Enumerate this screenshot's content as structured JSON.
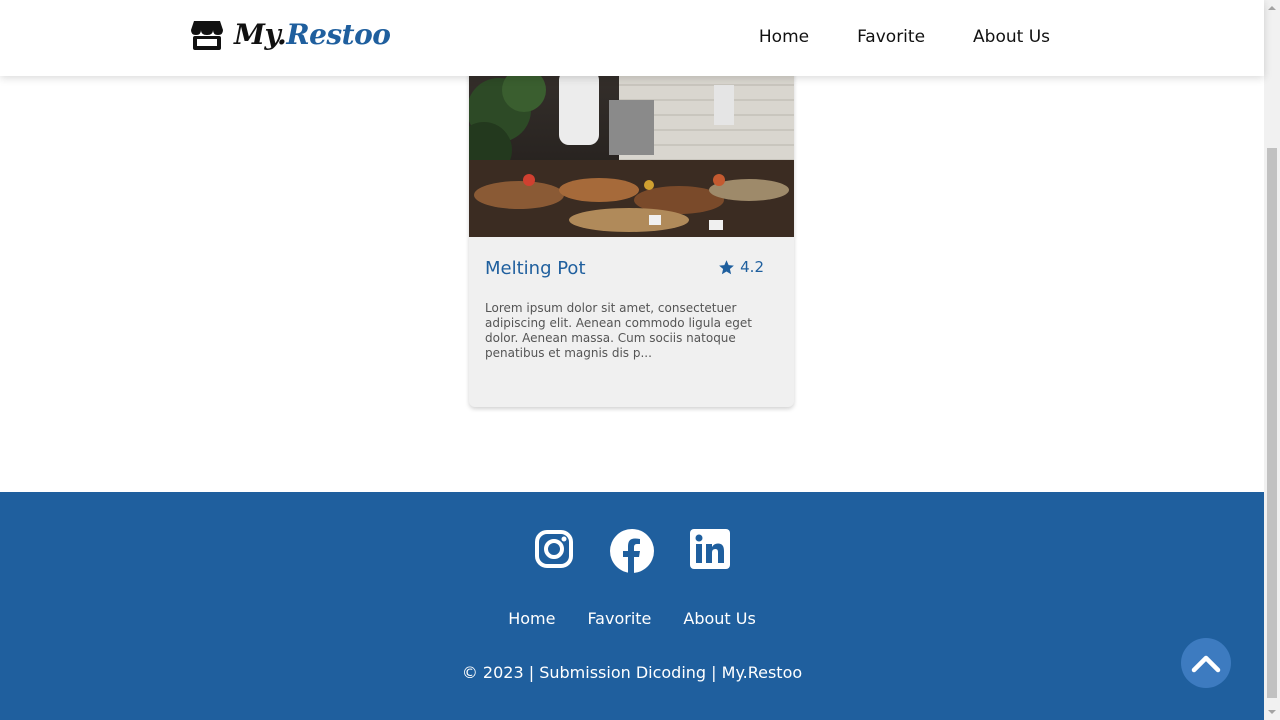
{
  "header": {
    "logo": {
      "prefix": "My.",
      "name": "Restoo",
      "icon": "store-icon"
    },
    "nav": [
      {
        "label": "Home"
      },
      {
        "label": "Favorite"
      },
      {
        "label": "About Us"
      }
    ]
  },
  "restaurant": {
    "name": "Melting Pot",
    "rating": "4.2",
    "rating_icon": "star-icon",
    "description": "Lorem ipsum dolor sit amet, consectetuer adipiscing elit. Aenean commodo ligula eget dolor. Aenean massa. Cum sociis natoque penatibus et magnis dis p...",
    "image_alt": "Melting Pot"
  },
  "footer": {
    "social": [
      "instagram-icon",
      "facebook-icon",
      "linkedin-icon"
    ],
    "nav": [
      {
        "label": "Home"
      },
      {
        "label": "Favorite"
      },
      {
        "label": "About Us"
      }
    ],
    "copyright": "© 2023 | Submission Dicoding | My.Restoo"
  },
  "back_to_top_icon": "chevron-up-icon",
  "colors": {
    "primary": "#1f5f9e",
    "back_to_top": "#3d7bc0",
    "card_bg": "#f0f0f0"
  }
}
